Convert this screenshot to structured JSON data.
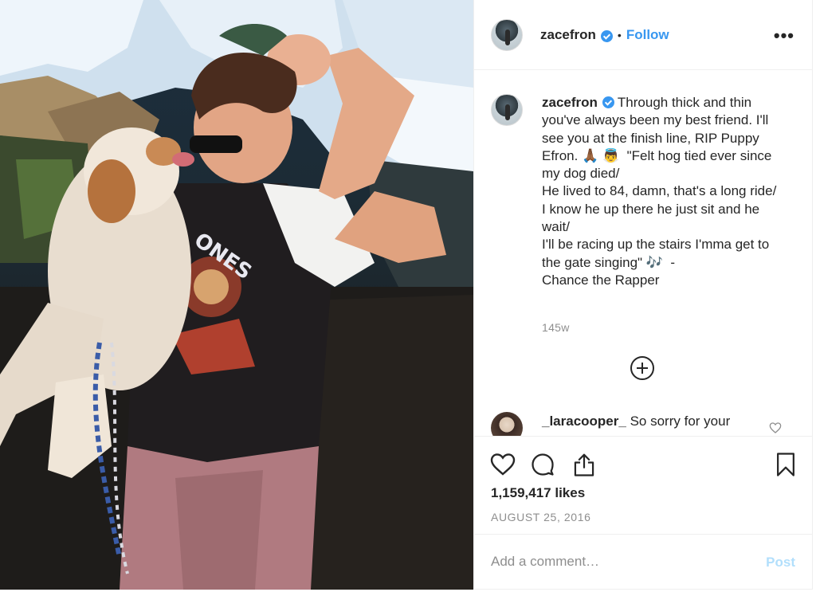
{
  "post": {
    "photo_alt": "",
    "header": {
      "username": "zacefron",
      "separator": "•",
      "follow_label": "Follow",
      "more_label": "•••"
    },
    "caption": {
      "username": "zacefron",
      "text": "Through thick and thin you've always been my best friend. I'll see you at the finish line, RIP Puppy Efron. 🙏🏾 👼  \"Felt hog tied ever since my dog died/\nHe lived to 84, damn, that's a long ride/\nI know he up there he just sit and he wait/\nI'll be racing up the stairs I'mma get to the gate singing\" 🎶  -\nChance the Rapper",
      "age": "145w"
    },
    "comments": [
      {
        "username": "_laracooper_",
        "text": "So sorry for your"
      }
    ],
    "likes": "1,159,417 likes",
    "date": "AUGUST 25, 2016",
    "add_comment": {
      "placeholder": "Add a comment…",
      "post_label": "Post"
    }
  },
  "icons": {
    "like": "heart-icon",
    "comment": "comment-icon",
    "share": "share-icon",
    "save": "bookmark-icon",
    "load_more": "plus-circle-icon",
    "verified": "verified-badge-icon"
  },
  "colors": {
    "accent": "#3897f0",
    "text": "#262626",
    "muted": "#8e8e8e",
    "post_disabled": "#b2dffc",
    "divider": "#efefef"
  }
}
